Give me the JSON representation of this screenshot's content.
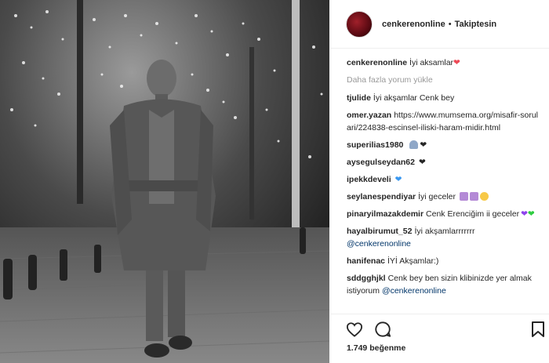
{
  "post": {
    "username": "cenkerenonline",
    "separator": "•",
    "follow_status": "Takiptesin"
  },
  "caption": {
    "username": "cenkerenonline",
    "text": "İyi aksamlar"
  },
  "load_more_label": "Daha fazla yorum yükle",
  "comments": [
    {
      "username": "tjulide",
      "text": "İyi akşamlar Cenk bey"
    },
    {
      "username": "omer.yazan",
      "text": "https://www.mumsema.org/misafir-sorulari/224838-escinsel-iliski-haram-midir.html"
    },
    {
      "username": "superilias1980",
      "text": ""
    },
    {
      "username": "aysegulseydan62",
      "text": ""
    },
    {
      "username": "ipekkdeveli",
      "text": ""
    },
    {
      "username": "seylanespendiyar",
      "text": "İyi geceler"
    },
    {
      "username": "pinaryilmazakdemir",
      "text": "Cenk Erenciğim ii geceler"
    },
    {
      "username": "hayalbirumut_52",
      "text": "İyi akşamlarrrrrrr",
      "mention": "@cenkerenonline"
    },
    {
      "username": "hanifenac",
      "text": "İYİ Akşamlar:)"
    },
    {
      "username": "sddgghjkl",
      "text": "Cenk bey ben sizin klibinizde yer almak istiyorum",
      "mention": "@cenkerenonline"
    }
  ],
  "likes_text": "1.749 beğenme",
  "icons": {
    "like": "heart-icon",
    "comment": "comment-icon",
    "save": "bookmark-icon"
  },
  "colors": {
    "heart_red": "#ed4956",
    "mention_blue": "#003569",
    "muted_gray": "#999999",
    "blue_heart": "#3897f0",
    "purple_heart": "#8e44ec",
    "green_heart": "#2ecc40"
  }
}
